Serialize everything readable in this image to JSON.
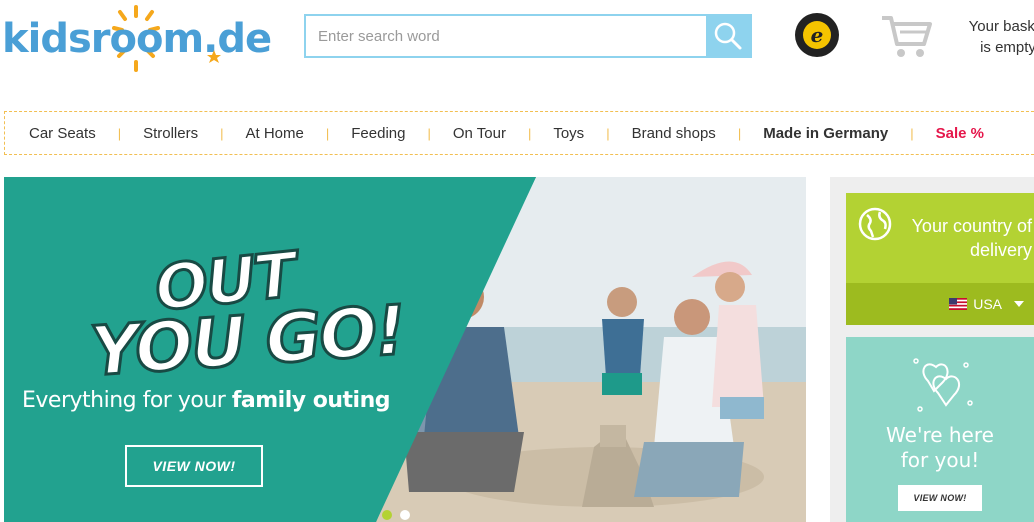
{
  "header": {
    "logo_text": "kidsroom.de",
    "search": {
      "placeholder": "Enter search word"
    },
    "trusted_badge_label": "TRUSTED SHOPS GUARANTEE",
    "basket": {
      "line1": "Your basket",
      "line2": "is empty"
    }
  },
  "nav": {
    "items": [
      {
        "label": "Car Seats"
      },
      {
        "label": "Strollers"
      },
      {
        "label": "At Home"
      },
      {
        "label": "Feeding"
      },
      {
        "label": "On Tour"
      },
      {
        "label": "Toys"
      },
      {
        "label": "Brand shops"
      },
      {
        "label": "Made in Germany"
      },
      {
        "label": "Sale %"
      }
    ],
    "separator": "|"
  },
  "hero": {
    "headline_line1": "OUT",
    "headline_line2": "YOU GO!",
    "tagline_regular": "Everything for your ",
    "tagline_bold": "family outing",
    "button_label": "VIEW NOW!",
    "slides_total": 2,
    "active_slide": 1
  },
  "sidebar": {
    "country": {
      "title": "Your country of delivery",
      "selected": "USA"
    },
    "help": {
      "title_line1": "We're here",
      "title_line2": "for you!",
      "button_label": "VIEW NOW!"
    }
  },
  "icons": {
    "search": "search-icon",
    "cart": "shopping-cart-icon",
    "globe": "globe-icon",
    "flag": "us-flag-icon",
    "hearts": "hearts-icon"
  },
  "colors": {
    "brand_blue": "#4a9fd6",
    "sun_orange": "#f5a81c",
    "search_border": "#8ed3ee",
    "nav_border": "#f2bf52",
    "sale_red": "#e5174b",
    "hero_teal": "#22a28f",
    "country_green": "#b3d233",
    "help_mint": "#8ed6c7"
  }
}
